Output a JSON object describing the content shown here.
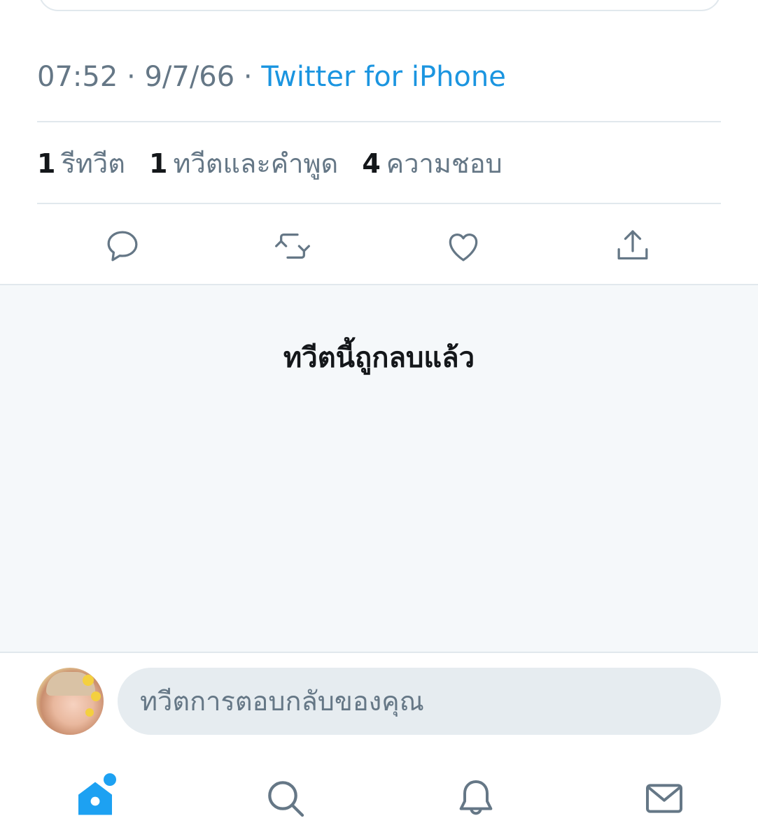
{
  "tweet": {
    "time": "07:52",
    "date": "9/7/66",
    "source": "Twitter for iPhone",
    "separator": "·"
  },
  "stats": {
    "retweets": {
      "count": "1",
      "label": "รีทวีต"
    },
    "quotes": {
      "count": "1",
      "label": "ทวีตและคำพูด"
    },
    "likes": {
      "count": "4",
      "label": "ความชอบ"
    }
  },
  "actions": {
    "reply_icon": "reply-bubble-icon",
    "retweet_icon": "retweet-icon",
    "like_icon": "heart-icon",
    "share_icon": "share-icon"
  },
  "deleted_notice": "ทวีตนี้ถูกลบแล้ว",
  "reply": {
    "placeholder": "ทวีตการตอบกลับของคุณ"
  },
  "tabbar": {
    "home_icon": "home-icon",
    "search_icon": "search-icon",
    "notifications_icon": "bell-icon",
    "messages_icon": "mail-icon"
  },
  "colors": {
    "accent": "#1da1f2",
    "link": "#1b95e0",
    "secondary_text": "#657786",
    "icon_gray": "#657786",
    "primary_text": "#14171a",
    "divider": "#e1e8ed",
    "deleted_bg": "#f5f8fa",
    "reply_bg": "#e6ecf0"
  }
}
